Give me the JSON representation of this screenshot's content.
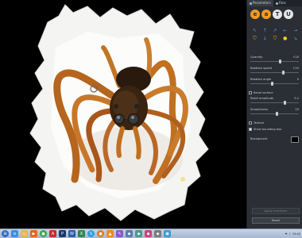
{
  "tabs": [
    {
      "label": "Parameters",
      "active": true
    },
    {
      "label": "Files",
      "active": false
    }
  ],
  "logo": {
    "letters": [
      "e",
      "a",
      "T",
      "U"
    ],
    "colors": [
      "#f39a1e",
      "#f39a1e",
      "#e6e6e6",
      "#e6e6e6"
    ]
  },
  "sliders": [
    {
      "label": "Quantity",
      "value": "+20",
      "level": 0.62
    },
    {
      "label": "Rotation speed",
      "value": "+20",
      "level": 0.68
    },
    {
      "label": "Rotation angle",
      "value": "0",
      "level": 0.45
    },
    {
      "label": "Relief amplitude",
      "value": "9.2",
      "level": 0.72
    },
    {
      "label": "Smoothness",
      "value": "20",
      "level": 0.55
    }
  ],
  "checks": [
    {
      "label": "Bevel surface",
      "checked": false
    },
    {
      "label": "Texture",
      "checked": false
    },
    {
      "label": "Show bounding box",
      "checked": true
    }
  ],
  "background": {
    "label": "Background",
    "color": "#000000"
  },
  "buttons": {
    "apply": "Apply transform",
    "reset": "Reset"
  },
  "taskbar": {
    "icons": [
      "start",
      "ie",
      "folder",
      "media",
      "chrome",
      "pdf",
      "ps",
      "word",
      "excel",
      "skype",
      "firefox",
      "vlc",
      "paint",
      "app",
      "app2",
      "app3",
      "app4",
      "photos"
    ],
    "clock": "19:42"
  }
}
